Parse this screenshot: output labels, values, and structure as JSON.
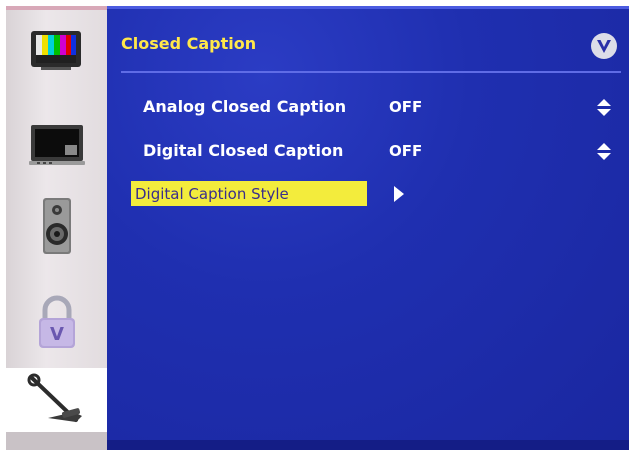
{
  "menu": {
    "title": "Closed Caption",
    "rows": [
      {
        "label": "Analog Closed Caption",
        "value": "OFF"
      },
      {
        "label": "Digital Closed Caption",
        "value": "OFF"
      },
      {
        "label": "Digital Caption Style"
      }
    ]
  },
  "sidebar": {
    "items": [
      {
        "icon": "picture-icon"
      },
      {
        "icon": "tv-input-icon"
      },
      {
        "icon": "speaker-icon"
      },
      {
        "icon": "lock-icon"
      },
      {
        "icon": "wrench-setup-icon",
        "selected": true
      }
    ]
  },
  "colors": {
    "panel": "#1f2fb0",
    "title": "#ffe84a",
    "highlight": "#f3ec3c",
    "highlight_text": "#3a2e8c",
    "text": "#ffffff"
  }
}
